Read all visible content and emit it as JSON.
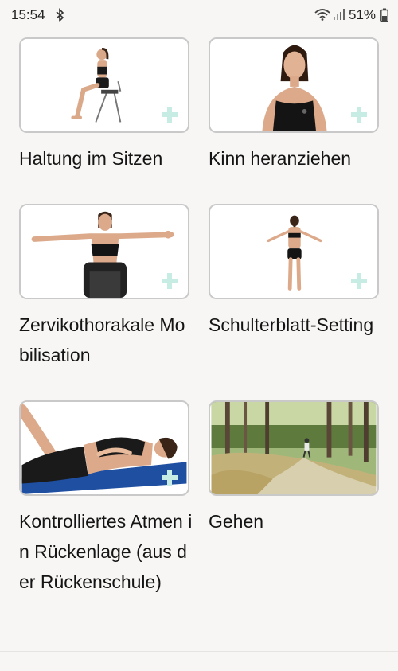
{
  "status_bar": {
    "time": "15:54",
    "battery": "51%",
    "icons": [
      "bluetooth-icon",
      "wifi-icon",
      "signal-icon",
      "battery-icon"
    ]
  },
  "exercises": [
    {
      "title": "Haltung im Sitzen",
      "image": "woman-sitting-on-chair"
    },
    {
      "title": "Kinn heranziehen",
      "image": "woman-upper-body-front"
    },
    {
      "title": "Zervikothorakale Mobilisation",
      "image": "woman-arms-spread-seated"
    },
    {
      "title": "Schulterblatt-Setting",
      "image": "woman-standing-back-view"
    },
    {
      "title": "Kontrolliertes Atmen in Rückenlage (aus der Rückenschule)",
      "image": "woman-lying-on-mat"
    },
    {
      "title": "Gehen",
      "image": "person-walking-forest-path"
    }
  ],
  "colors": {
    "background": "#f7f6f4",
    "card_border": "#c9c9c9",
    "plus_icon": "#c6ece4",
    "mat": "#1f4fa0"
  }
}
